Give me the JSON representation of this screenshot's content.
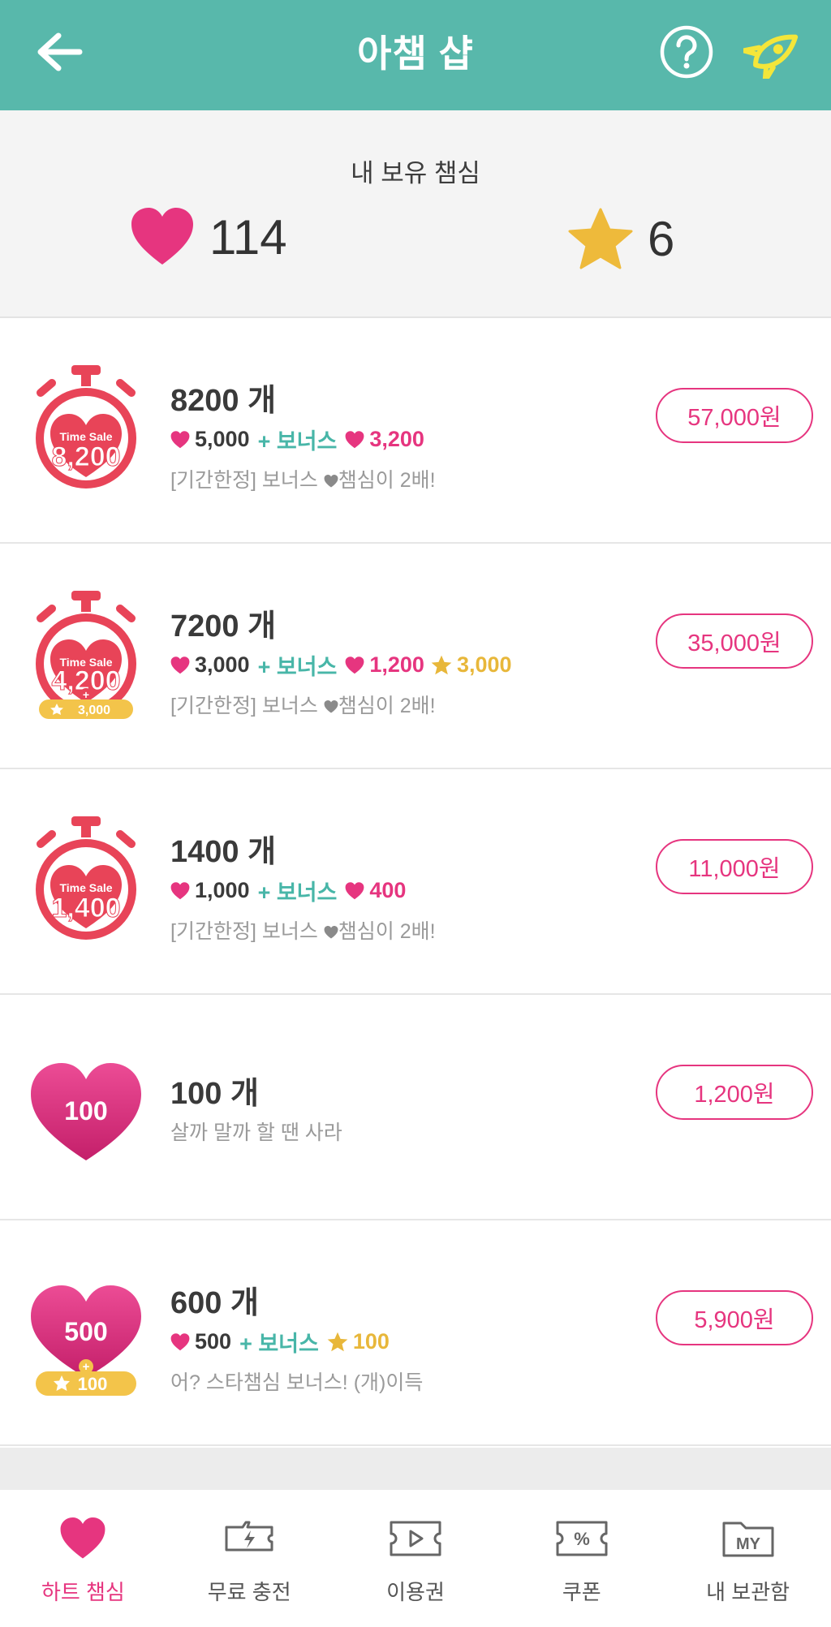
{
  "header": {
    "title": "아챔 샵"
  },
  "balance": {
    "label": "내 보유 챔심",
    "heart_count": "114",
    "star_count": "6"
  },
  "products": [
    {
      "icon_top": "Time Sale",
      "icon_number": "8,200",
      "title": "8200 개",
      "base": "5,000",
      "bonus_label": "+ 보너스",
      "bonus_heart": "3,200",
      "desc_prefix": "[기간한정] 보너스",
      "desc_suffix": "챔심이 2배!",
      "price": "57,000원"
    },
    {
      "icon_top": "Time Sale",
      "icon_number": "4,200",
      "icon_plus": "+",
      "icon_badge": "3,000",
      "title": "7200 개",
      "base": "3,000",
      "bonus_label": "+ 보너스",
      "bonus_heart": "1,200",
      "bonus_star": "3,000",
      "desc_prefix": "[기간한정] 보너스",
      "desc_suffix": "챔심이 2배!",
      "price": "35,000원"
    },
    {
      "icon_top": "Time Sale",
      "icon_number": "1,400",
      "title": "1400 개",
      "base": "1,000",
      "bonus_label": "+ 보너스",
      "bonus_heart": "400",
      "desc_prefix": "[기간한정] 보너스",
      "desc_suffix": "챔심이 2배!",
      "price": "11,000원"
    },
    {
      "icon_number": "100",
      "title": "100 개",
      "desc": "살까 말까 할 땐 사라",
      "price": "1,200원"
    },
    {
      "icon_number": "500",
      "icon_plus": "+",
      "icon_badge": "100",
      "title": "600 개",
      "base": "500",
      "bonus_label": "+ 보너스",
      "bonus_star": "100",
      "desc": "어? 스타챔심 보너스! (개)이득",
      "price": "5,900원"
    }
  ],
  "bottom_nav": [
    {
      "label": "하트 챔심",
      "icon": "heart-icon",
      "active": true
    },
    {
      "label": "무료 충전",
      "icon": "free-charge-icon"
    },
    {
      "label": "이용권",
      "icon": "ticket-icon"
    },
    {
      "label": "쿠폰",
      "icon": "coupon-icon"
    },
    {
      "label": "내 보관함",
      "icon": "my-storage-icon",
      "icon_text": "MY"
    }
  ],
  "colors": {
    "header": "#58b8ab",
    "pink": "#e6357f",
    "teal": "#48b6a8",
    "gold": "#e8b73a",
    "timer_red": "#e84458"
  }
}
